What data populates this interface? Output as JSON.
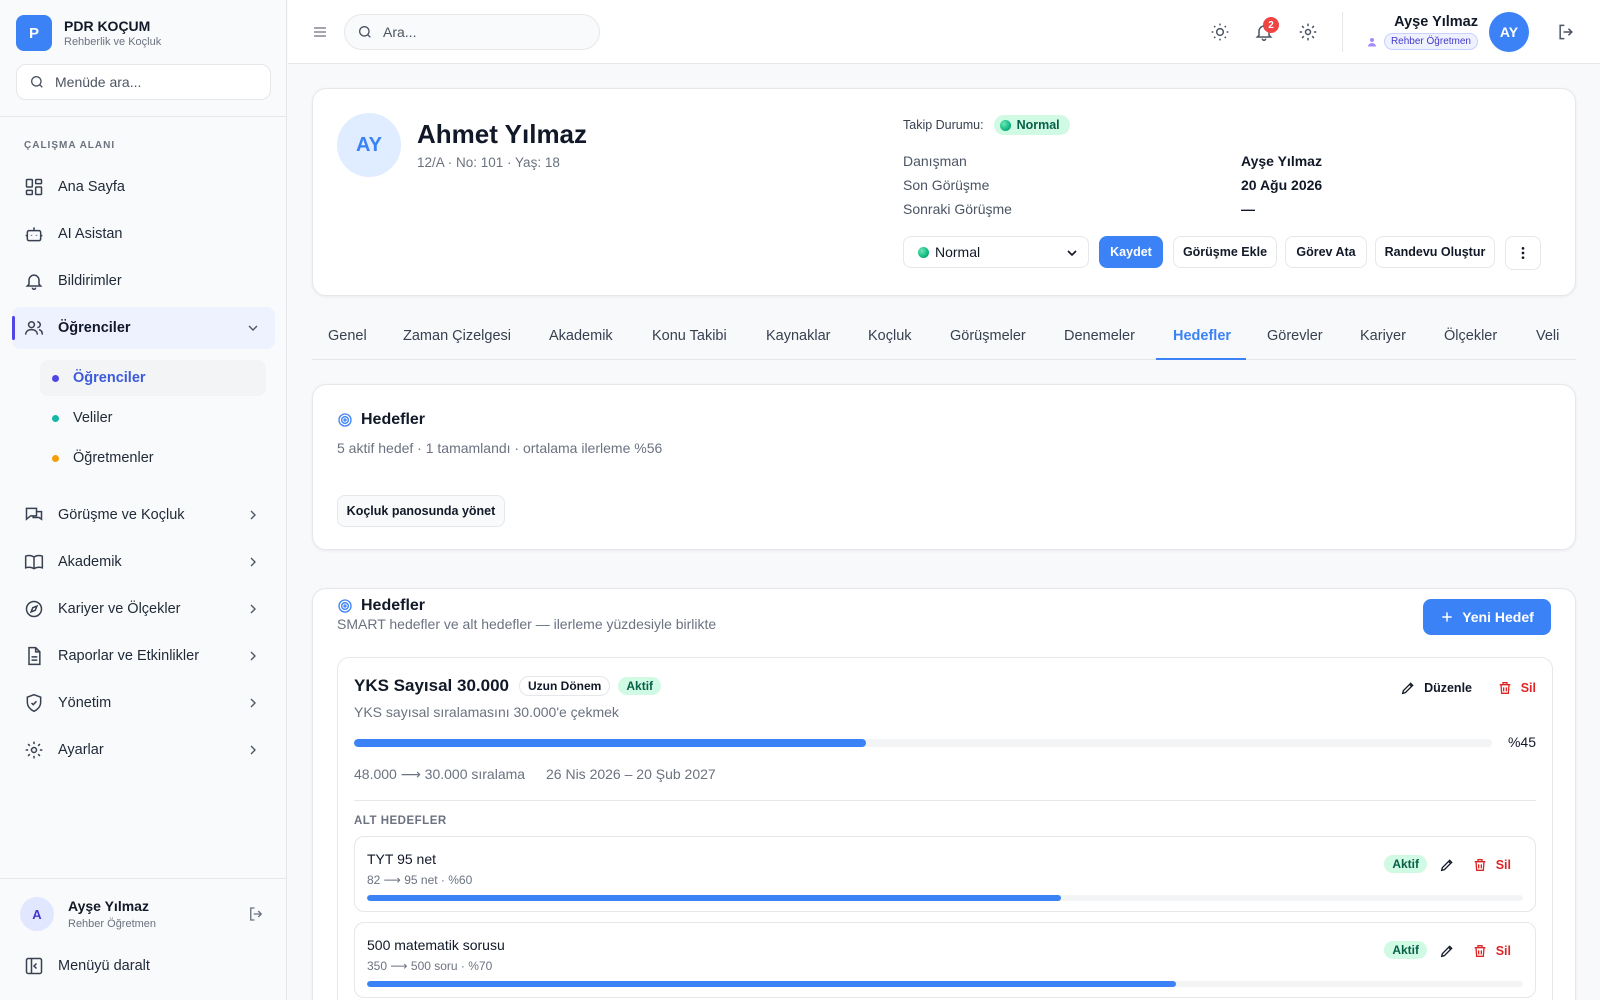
{
  "brand": {
    "logo_letter": "P",
    "name": "PDR KOÇUM",
    "subtitle": "Rehberlik ve Koçluk"
  },
  "sidebar": {
    "search_placeholder": "Menüde ara...",
    "section_label": "ÇALIŞMA ALANI",
    "items": [
      {
        "label": "Ana Sayfa",
        "icon": "grid-icon"
      },
      {
        "label": "AI Asistan",
        "icon": "robot-icon"
      },
      {
        "label": "Bildirimler",
        "icon": "bell-icon"
      },
      {
        "label": "Öğrenciler",
        "icon": "users-icon",
        "expanded": true
      },
      {
        "label": "Görüşme ve Koçluk",
        "icon": "chat-icon"
      },
      {
        "label": "Akademik",
        "icon": "book-icon"
      },
      {
        "label": "Kariyer ve Ölçekler",
        "icon": "compass-icon"
      },
      {
        "label": "Raporlar ve Etkinlikler",
        "icon": "file-icon"
      },
      {
        "label": "Yönetim",
        "icon": "shield-icon"
      },
      {
        "label": "Ayarlar",
        "icon": "gear-icon"
      }
    ],
    "sub_items": [
      {
        "label": "Öğrenciler",
        "color": "#4f46e5"
      },
      {
        "label": "Veliler",
        "color": "#14b8a6"
      },
      {
        "label": "Öğretmenler",
        "color": "#f59e0b"
      }
    ],
    "footer": {
      "avatar": "A",
      "name": "Ayşe Yılmaz",
      "role": "Rehber Öğretmen",
      "collapse_label": "Menüyü daralt"
    }
  },
  "topbar": {
    "search_placeholder": "Ara...",
    "notification_count": "2",
    "user_name": "Ayşe Yılmaz",
    "user_role": "Rehber Öğretmen",
    "user_initials": "AY"
  },
  "student": {
    "initials": "AY",
    "name": "Ahmet Yılmaz",
    "meta": "12/A · No: 101 · Yaş: 18",
    "status_label": "Takip Durumu:",
    "status_value": "Normal",
    "info": [
      {
        "label": "Danışman",
        "value": "Ayşe Yılmaz"
      },
      {
        "label": "Son Görüşme",
        "value": "20 Ağu 2026"
      },
      {
        "label": "Sonraki Görüşme",
        "value": "—"
      }
    ],
    "status_select": "Normal",
    "buttons": {
      "save": "Kaydet",
      "add_meeting": "Görüşme Ekle",
      "assign_task": "Görev Ata",
      "create_appointment": "Randevu Oluştur"
    }
  },
  "tabs": [
    "Genel",
    "Zaman Çizelgesi",
    "Akademik",
    "Konu Takibi",
    "Kaynaklar",
    "Koçluk",
    "Görüşmeler",
    "Denemeler",
    "Hedefler",
    "Görevler",
    "Kariyer",
    "Ölçekler",
    "Veli"
  ],
  "active_tab": "Hedefler",
  "summary": {
    "title": "Hedefler",
    "subtitle": "5 aktif hedef · 1 tamamlandı · ortalama ilerleme %56",
    "button": "Koçluk panosunda yönet"
  },
  "goals_panel": {
    "title": "Hedefler",
    "subtitle": "SMART hedefler ve alt hedefler — ilerleme yüzdesiyle birlikte",
    "new_button": "Yeni Hedef"
  },
  "goal": {
    "title": "YKS Sayısal 30.000",
    "term_tag": "Uzun Dönem",
    "status_tag": "Aktif",
    "description": "YKS sayısal sıralamasını 30.000'e çekmek",
    "edit_label": "Düzenle",
    "delete_label": "Sil",
    "progress": 45,
    "progress_label": "%45",
    "range": "48.000 ⟶ 30.000 sıralama",
    "dates": "26 Nis 2026 – 20 Şub 2027",
    "subgoals_label": "ALT HEDEFLER",
    "subgoals": [
      {
        "title": "TYT 95 net",
        "meta": "82 ⟶ 95 net · %60",
        "status": "Aktif",
        "delete_label": "Sil",
        "progress": 60
      },
      {
        "title": "500 matematik sorusu",
        "meta": "350 ⟶ 500 soru · %70",
        "status": "Aktif",
        "delete_label": "Sil",
        "progress": 70
      }
    ]
  },
  "colors": {
    "primary": "#3b82f6",
    "active_nav": "#4f46e5",
    "success_bg": "#d1fae5",
    "success_text": "#065f46",
    "danger": "#dc2626"
  }
}
